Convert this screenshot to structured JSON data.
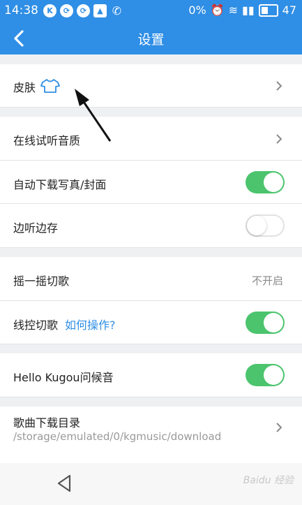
{
  "status_bar": {
    "time": "14:38",
    "data_speed": "0%",
    "battery": "47",
    "icons": [
      "k-app-icon",
      "sync-icon",
      "sync-icon-2",
      "image-icon",
      "missed-call-icon",
      "alarm-icon",
      "wifi-icon",
      "signal-icon",
      "battery-icon"
    ]
  },
  "toolbar": {
    "title": "设置",
    "back_icon": "back-arrow-icon"
  },
  "settings": {
    "skin": {
      "label": "皮肤",
      "icon": "tshirt-icon"
    },
    "online_quality": {
      "label": "在线试听音质"
    },
    "auto_download_cover": {
      "label": "自动下载写真/封面",
      "enabled": true
    },
    "listen_and_save": {
      "label": "边听边存",
      "enabled": false
    },
    "shake_switch": {
      "label": "摇一摇切歌",
      "value": "不开启"
    },
    "wire_control": {
      "label": "线控切歌",
      "link": "如何操作?",
      "enabled": true
    },
    "greeting": {
      "label": "Hello Kugou问候音",
      "enabled": true
    },
    "download_dir": {
      "label": "歌曲下载目录",
      "path": "/storage/emulated/0/kgmusic/download"
    }
  },
  "nav_bar": {
    "back_icon": "nav-back-triangle-icon"
  },
  "watermark": "Baidu 经验",
  "colors": {
    "brand_blue": "#2f8ee5",
    "toggle_green": "#4cc46e",
    "annotation_arrow": "#111111"
  }
}
